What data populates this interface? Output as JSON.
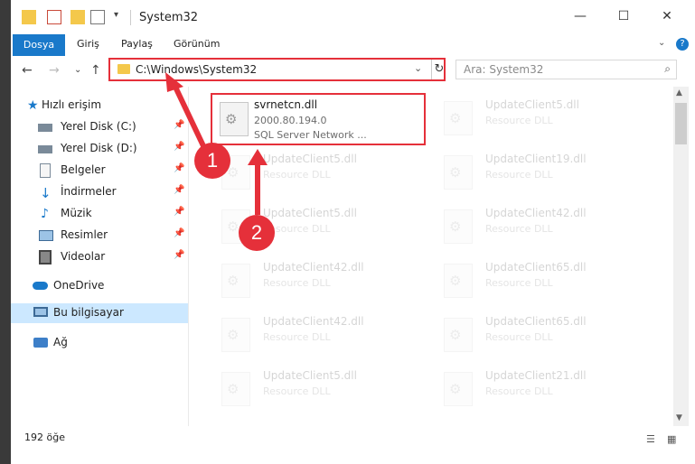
{
  "window": {
    "title": "System32"
  },
  "ribbon": {
    "tabs": [
      "Dosya",
      "Giriş",
      "Paylaş",
      "Görünüm"
    ],
    "help": "?"
  },
  "caption": {
    "minimize": "—",
    "maximize": "☐",
    "close": "✕"
  },
  "address": {
    "path": "C:\\Windows\\System32",
    "dropdown": "⌄",
    "refresh": "↻"
  },
  "search": {
    "placeholder": "Ara: System32"
  },
  "nav": {
    "back": "←",
    "forward": "→",
    "recent": "⌄",
    "up": "↑"
  },
  "sidebar": {
    "items": [
      {
        "label": "Hızlı erişim",
        "icon": "star-icon",
        "pinned": false
      },
      {
        "label": "Yerel Disk (C:)",
        "icon": "drive-icon",
        "pinned": true
      },
      {
        "label": "Yerel Disk (D:)",
        "icon": "drive-icon",
        "pinned": true
      },
      {
        "label": "Belgeler",
        "icon": "document-icon",
        "pinned": true
      },
      {
        "label": "İndirmeler",
        "icon": "download-icon",
        "pinned": true
      },
      {
        "label": "Müzik",
        "icon": "music-icon",
        "pinned": true
      },
      {
        "label": "Resimler",
        "icon": "pictures-icon",
        "pinned": true
      },
      {
        "label": "Videolar",
        "icon": "video-icon",
        "pinned": true
      },
      {
        "label": "OneDrive",
        "icon": "cloud-icon",
        "pinned": false
      },
      {
        "label": "Bu bilgisayar",
        "icon": "computer-icon",
        "pinned": false
      },
      {
        "label": "Ağ",
        "icon": "network-icon",
        "pinned": false
      }
    ]
  },
  "files": {
    "main": {
      "name": "svrnetcn.dll",
      "version": "2000.80.194.0",
      "desc": "SQL Server Network ..."
    },
    "left_col": [
      {
        "name": "UpdateClient5.dll",
        "type": "Resource DLL"
      },
      {
        "name": "UpdateClient5.dll",
        "type": "Resource DLL"
      },
      {
        "name": "UpdateClient42.dll",
        "type": "Resource DLL"
      },
      {
        "name": "UpdateClient42.dll",
        "type": "Resource DLL"
      },
      {
        "name": "UpdateClient5.dll",
        "type": "Resource DLL"
      }
    ],
    "right_col": [
      {
        "name": "UpdateClient5.dll",
        "type": "Resource DLL"
      },
      {
        "name": "UpdateClient19.dll",
        "type": "Resource DLL"
      },
      {
        "name": "UpdateClient42.dll",
        "type": "Resource DLL"
      },
      {
        "name": "UpdateClient65.dll",
        "type": "Resource DLL"
      },
      {
        "name": "UpdateClient65.dll",
        "type": "Resource DLL"
      },
      {
        "name": "UpdateClient21.dll",
        "type": "Resource DLL"
      }
    ]
  },
  "status": {
    "count": "192 öğe"
  },
  "annotations": {
    "step1": "1",
    "step2": "2",
    "color": "#e5303a"
  }
}
